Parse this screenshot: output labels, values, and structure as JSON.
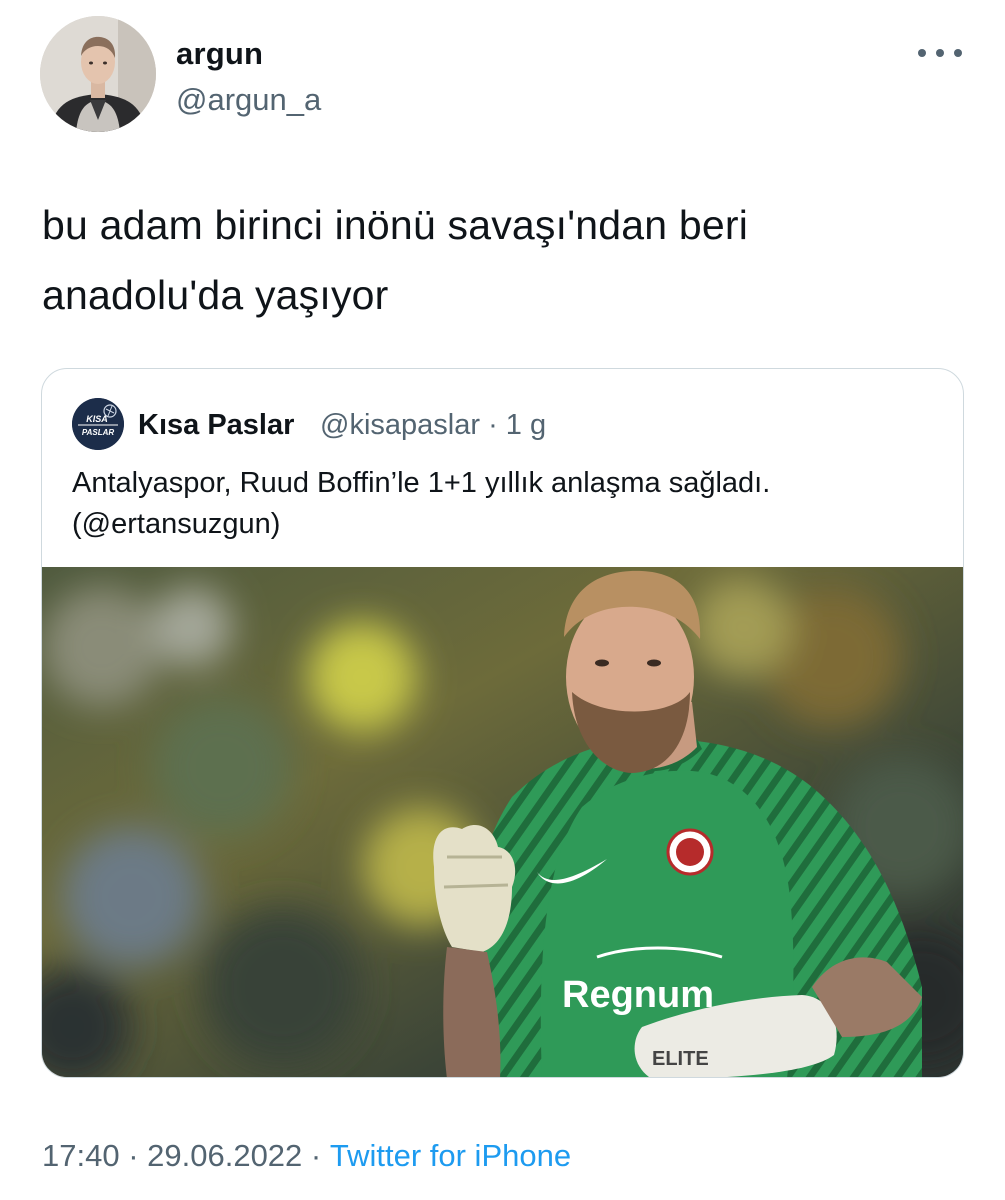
{
  "author": {
    "display_name": "argun",
    "handle": "@argun_a"
  },
  "icons": {
    "more": "more-horizontal-icon",
    "author_avatar": "user-avatar",
    "quote_avatar": "kisa-paslar-logo"
  },
  "tweet": {
    "line1": "bu adam birinci inönü savaşı'ndan beri",
    "line2": "anadolu'da yaşıyor"
  },
  "quote": {
    "display_name": "Kısa Paslar",
    "handle": "@kisapaslar",
    "separator": "·",
    "time": "1 g",
    "text_line1": "Antalyaspor, Ruud Boffin’le 1+1 yıllık anlaşma sağladı.",
    "text_line2": "(@ertansuzgun)",
    "logo_text_top": "KISA",
    "logo_text_bottom": "PASLAR",
    "photo": {
      "jersey_sponsor": "Regnum",
      "glove_brand": "ELITE"
    }
  },
  "footer": {
    "time": "17:40",
    "separator": " · ",
    "date": "29.06.2022",
    "source": "Twitter for iPhone"
  },
  "colors": {
    "text": "#0f1419",
    "secondary": "#536471",
    "link": "#1d9bf0",
    "border": "#cfd9de",
    "jersey": "#2f9a58"
  }
}
